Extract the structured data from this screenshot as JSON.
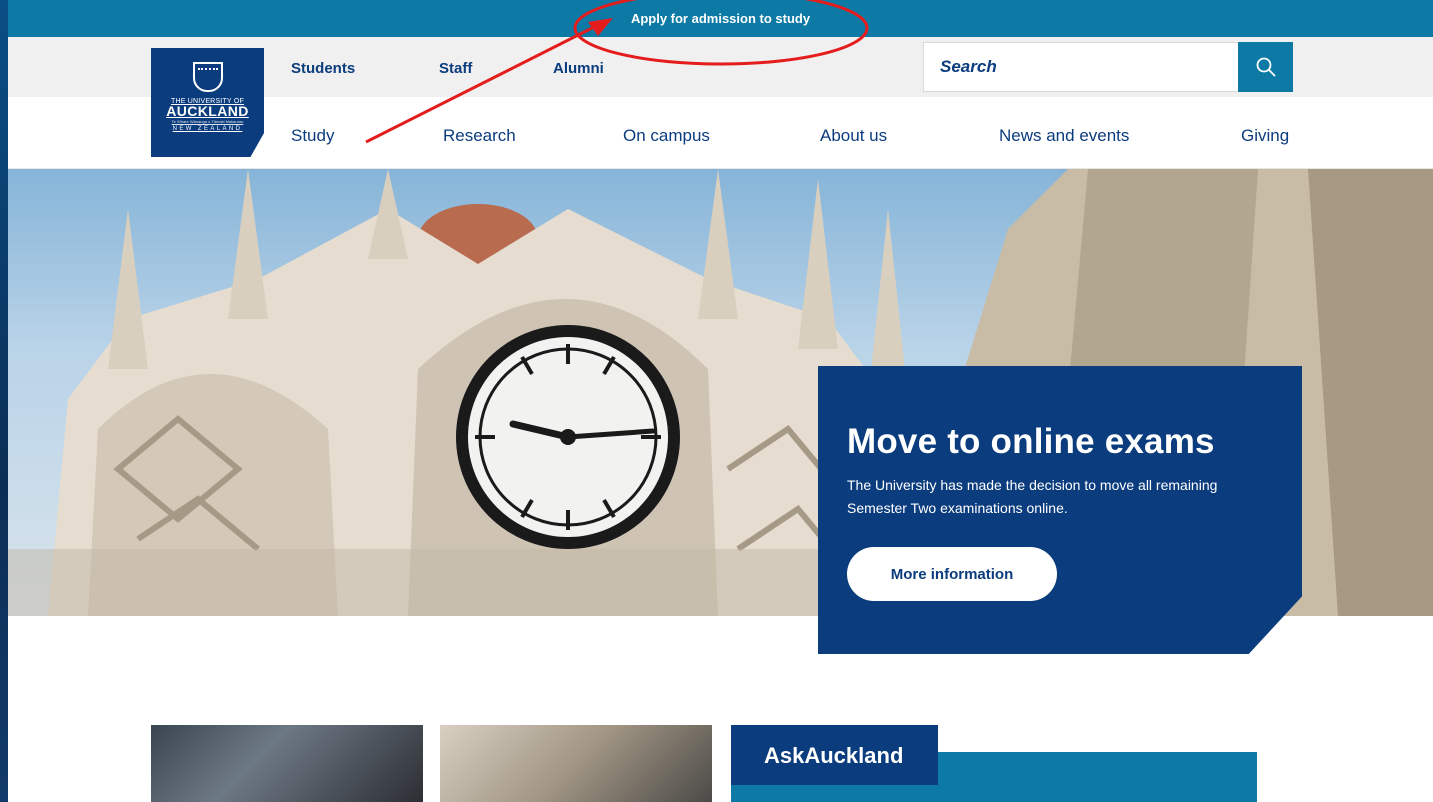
{
  "banner": {
    "apply_label": "Apply for admission to study"
  },
  "logo": {
    "line1": "THE UNIVERSITY OF",
    "line2": "AUCKLAND",
    "line3": "Te Whare Wānanga o Tāmaki Makaurau",
    "line4": "NEW ZEALAND"
  },
  "utility_nav": {
    "students": "Students",
    "staff": "Staff",
    "alumni": "Alumni"
  },
  "search": {
    "placeholder": "Search",
    "icon": "search-icon"
  },
  "main_nav": {
    "study": "Study",
    "research": "Research",
    "on_campus": "On campus",
    "about_us": "About us",
    "news_and_events": "News and events",
    "giving": "Giving"
  },
  "hero": {
    "title": "Move to online exams",
    "text": "The University has made the decision to move all remaining Semester Two examinations online.",
    "button_label": "More information"
  },
  "ask": {
    "title": "AskAuckland"
  },
  "colors": {
    "navy": "#0b3c7d",
    "teal": "#0c7aa5",
    "annotation_red": "#e51c1c"
  }
}
